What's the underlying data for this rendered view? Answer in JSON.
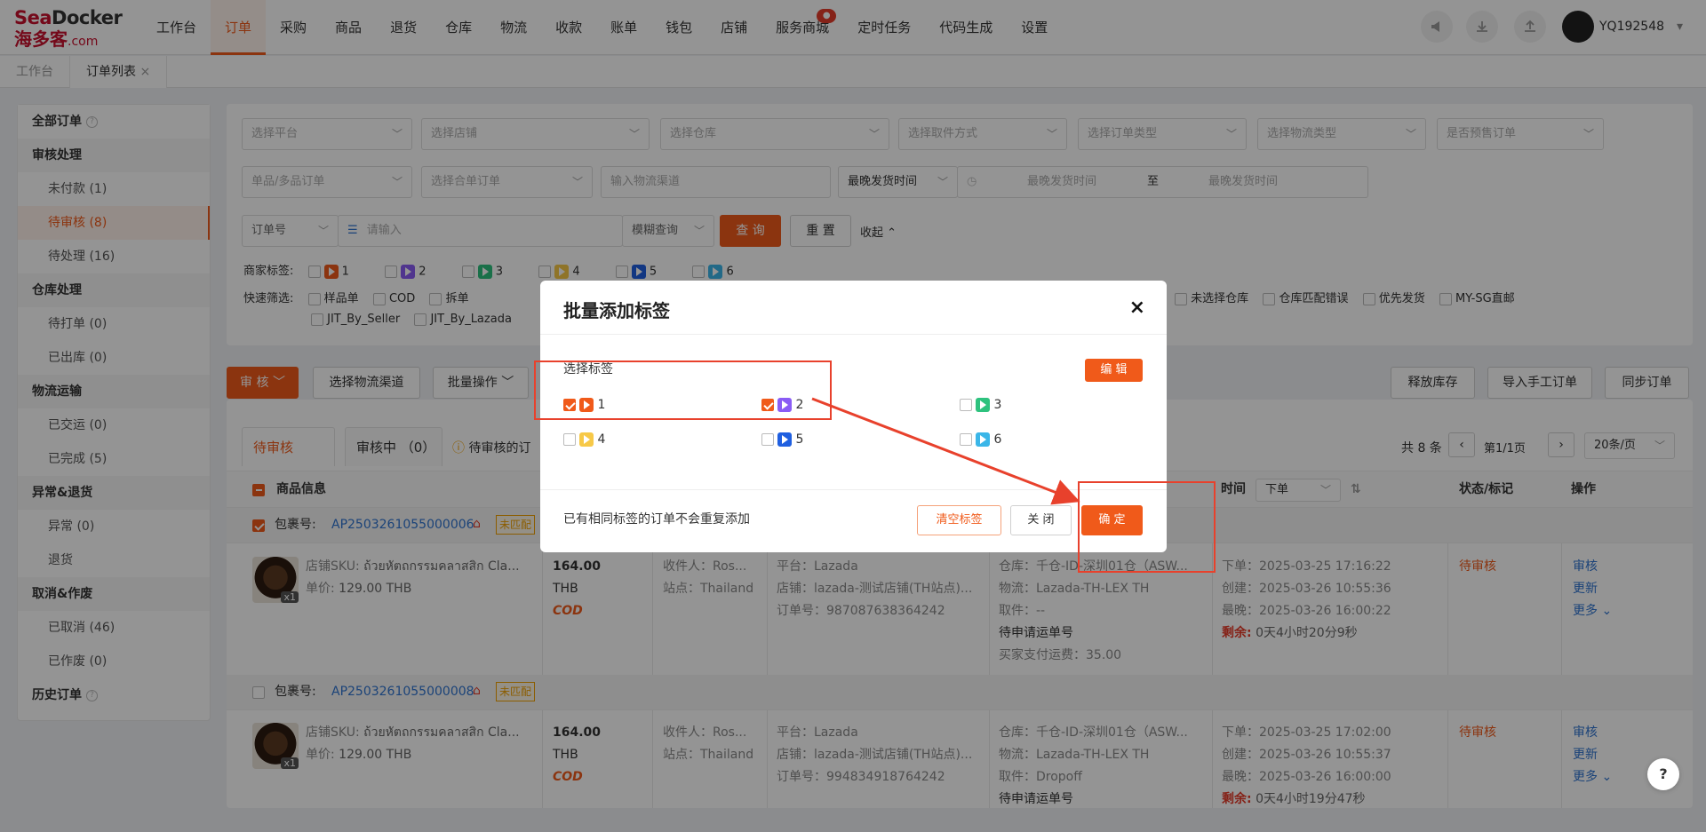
{
  "logo": {
    "brand_a": "Sea",
    "brand_b": "Docker",
    "cn": "海多客",
    "domain": ".com"
  },
  "nav": {
    "items": [
      "工作台",
      "订单",
      "采购",
      "商品",
      "退货",
      "仓库",
      "物流",
      "收款",
      "账单",
      "钱包",
      "店铺",
      "服务商城",
      "定时任务",
      "代码生成",
      "设置"
    ],
    "active_index": 1,
    "service_badge": "●"
  },
  "user": {
    "name": "YQ192548",
    "caret": "▾"
  },
  "tabs": {
    "home": "工作台",
    "order_list": "订单列表",
    "close": "×"
  },
  "sidebar": {
    "all_orders": "全部订单",
    "groups": [
      {
        "title": "审核处理",
        "items": [
          "未付款 (1)",
          "待审核 (8)",
          "待处理 (16)"
        ]
      },
      {
        "title": "仓库处理",
        "items": [
          "待打单 (0)",
          "已出库 (0)"
        ]
      },
      {
        "title": "物流运输",
        "items": [
          "已交运 (0)",
          "已完成 (5)"
        ]
      },
      {
        "title": "异常&退货",
        "items": [
          "异常 (0)",
          "退货"
        ]
      },
      {
        "title": "取消&作废",
        "items": [
          "已取消 (46)",
          "已作废 (0)"
        ]
      }
    ],
    "history": "历史订单",
    "help": "?"
  },
  "filters": {
    "row1": [
      "选择平台",
      "选择店铺",
      "选择仓库",
      "选择取件方式",
      "选择订单类型",
      "选择物流类型",
      "是否预售订单"
    ],
    "row2_item": "单品/多品订单",
    "row2_merge": "选择合单订单",
    "row2_channel_ph": "输入物流渠道",
    "row2_time_type": "最晚发货时间",
    "time_start_ph": "最晚发货时间",
    "time_to": "至",
    "time_end_ph": "最晚发货时间",
    "order_no": "订单号",
    "search_ph": "请输入",
    "fuzzy": "模糊查询",
    "query": "查 询",
    "reset": "重 置",
    "collapse": "收起",
    "merchant_tags_label": "商家标签:",
    "merchant_tags": [
      "1",
      "2",
      "3",
      "4",
      "5",
      "6"
    ],
    "quick_label": "快速筛选:",
    "quick_left": [
      "样品单",
      "COD",
      "拆单"
    ],
    "quick_right": [
      "未选择仓库",
      "仓库匹配错误",
      "优先发货",
      "MY-SG直邮"
    ],
    "quick_row2": [
      "JIT_By_Seller",
      "JIT_By_Lazada"
    ]
  },
  "toolbar": {
    "review": "审 核",
    "choose_channel": "选择物流渠道",
    "batch": "批量操作",
    "release_stock": "释放库存",
    "import_manual": "导入手工订单",
    "sync": "同步订单"
  },
  "list": {
    "tab_pending": "待审核 （8）",
    "tab_reviewing": "审核中 （0）",
    "notice": "待审核的订",
    "total": "共 8 条",
    "page": "第1/1页",
    "page_size": "20条/页",
    "col_product": "商品信息",
    "col_time": "时间",
    "time_sort": "下单",
    "col_status": "状态/标记",
    "col_ops": "操作",
    "orders": [
      {
        "pkg_label": "包裹号:",
        "pkg_no": "AP2503261055000006",
        "match": "未匹配",
        "sku_label": "店铺SKU:",
        "sku": "ถ้วยหัตถกรรมคลาสสิก Cla...",
        "price_label": "单价:",
        "price": "129.00 THB",
        "qty": "x1",
        "amount": "164.00",
        "currency": "THB",
        "cod": "COD",
        "receiver": "收件人：Ros...",
        "site": "站点：Thailand",
        "platform": "平台：Lazada",
        "shop": "店铺：lazada-测试店铺(TH站点)...",
        "order_no": "订单号：987087638364242",
        "warehouse": "仓库：千仓-ID-深圳01仓（ASW...",
        "logistics": "物流：Lazada-TH-LEX TH",
        "pickup": "取件：--",
        "pending_track": "待申请运单号",
        "freight": "买家支付运费：35.00",
        "t_order": "下单：2025-03-25 17:16:22",
        "t_create": "创建：2025-03-26 10:55:36",
        "t_latest": "最晚：2025-03-26 16:00:22",
        "remain_label": "剩余:",
        "remain": "0天4小时20分9秒",
        "status": "待审核",
        "ops": [
          "审核",
          "更新",
          "更多 ⌄"
        ]
      },
      {
        "pkg_label": "包裹号:",
        "pkg_no": "AP2503261055000008",
        "match": "未匹配",
        "sku_label": "店铺SKU:",
        "sku": "ถ้วยหัตถกรรมคลาสสิก Cla...",
        "price_label": "单价:",
        "price": "129.00 THB",
        "qty": "x1",
        "amount": "164.00",
        "currency": "THB",
        "cod": "COD",
        "receiver": "收件人：Ros...",
        "site": "站点：Thailand",
        "platform": "平台：Lazada",
        "shop": "店铺：lazada-测试店铺(TH站点)...",
        "order_no": "订单号：994834918764242",
        "warehouse": "仓库：千仓-ID-深圳01仓（ASW...",
        "logistics": "物流：Lazada-TH-LEX TH",
        "pickup": "取件：Dropoff",
        "pending_track": "待申请运单号",
        "t_order": "下单：2025-03-25 17:02:00",
        "t_create": "创建：2025-03-26 10:55:37",
        "t_latest": "最晚：2025-03-26 16:00:00",
        "remain_label": "剩余:",
        "remain": "0天4小时19分47秒",
        "status": "待审核",
        "ops": [
          "审核",
          "更新",
          "更多 ⌄"
        ]
      }
    ]
  },
  "modal": {
    "title": "批量添加标签",
    "close": "×",
    "select_label": "选择标签",
    "edit": "编 辑",
    "tags": [
      {
        "label": "1",
        "checked": true,
        "color": "#f05a1a"
      },
      {
        "label": "2",
        "checked": true,
        "color": "#8a5cf5"
      },
      {
        "label": "3",
        "checked": false,
        "color": "#2ec27e"
      },
      {
        "label": "4",
        "checked": false,
        "color": "#f7c948"
      },
      {
        "label": "5",
        "checked": false,
        "color": "#1f5fe0"
      },
      {
        "label": "6",
        "checked": false,
        "color": "#3bb6e8"
      }
    ],
    "note": "已有相同标签的订单不会重复添加",
    "clear": "清空标签",
    "cancel": "关 闭",
    "confirm": "确 定"
  },
  "colors": {
    "accent": "#f05a1a",
    "annotation": "#e8412c",
    "link": "#2f74d0"
  },
  "help_fab": "?"
}
